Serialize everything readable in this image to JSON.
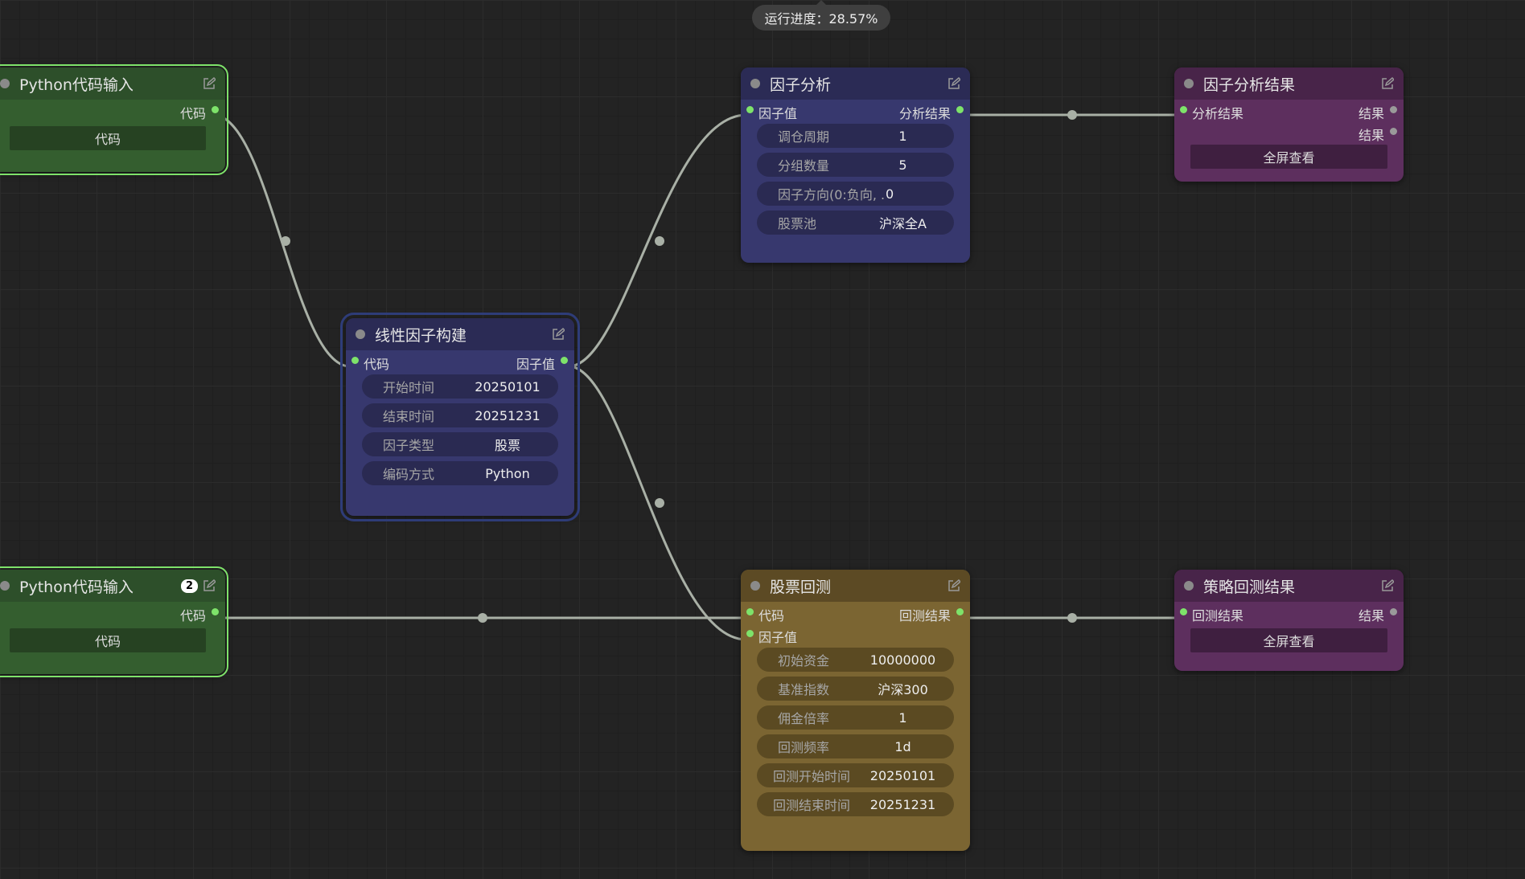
{
  "progress": {
    "label": "运行进度：28.57%"
  },
  "nodes": {
    "python_input_1": {
      "title": "Python代码输入",
      "output_label": "代码",
      "button_label": "代码"
    },
    "python_input_2": {
      "title": "Python代码输入",
      "badge": "2",
      "output_label": "代码",
      "button_label": "代码"
    },
    "linear_factor": {
      "title": "线性因子构建",
      "input_label": "代码",
      "output_label": "因子值",
      "widgets": [
        {
          "label": "开始时间",
          "value": "20250101"
        },
        {
          "label": "结束时间",
          "value": "20251231"
        },
        {
          "label": "因子类型",
          "value": "股票"
        },
        {
          "label": "编码方式",
          "value": "Python"
        }
      ]
    },
    "factor_analysis": {
      "title": "因子分析",
      "input_label": "因子值",
      "output_label": "分析结果",
      "widgets": [
        {
          "label": "调仓周期",
          "value": "1"
        },
        {
          "label": "分组数量",
          "value": "5"
        },
        {
          "label": "因子方向(0:负向, ...",
          "value": "0"
        },
        {
          "label": "股票池",
          "value": "沪深全A"
        }
      ]
    },
    "factor_result": {
      "title": "因子分析结果",
      "input_label": "分析结果",
      "output_label_1": "结果",
      "output_label_2": "结果",
      "button_label": "全屏查看"
    },
    "stock_backtest": {
      "title": "股票回测",
      "input_label_1": "代码",
      "input_label_2": "因子值",
      "output_label": "回测结果",
      "widgets": [
        {
          "label": "初始资金",
          "value": "10000000"
        },
        {
          "label": "基准指数",
          "value": "沪深300"
        },
        {
          "label": "佣金倍率",
          "value": "1"
        },
        {
          "label": "回测频率",
          "value": "1d"
        },
        {
          "label": "回测开始时间",
          "value": "20250101"
        },
        {
          "label": "回测结束时间",
          "value": "20251231"
        }
      ]
    },
    "strategy_result": {
      "title": "策略回测结果",
      "input_label": "回测结果",
      "output_label": "结果",
      "button_label": "全屏查看"
    }
  },
  "colors": {
    "link": "#a9b0a6",
    "pin_active": "#7ee36a",
    "selection_green": "#7ee36a",
    "selection_blue": "#2e3c78"
  }
}
